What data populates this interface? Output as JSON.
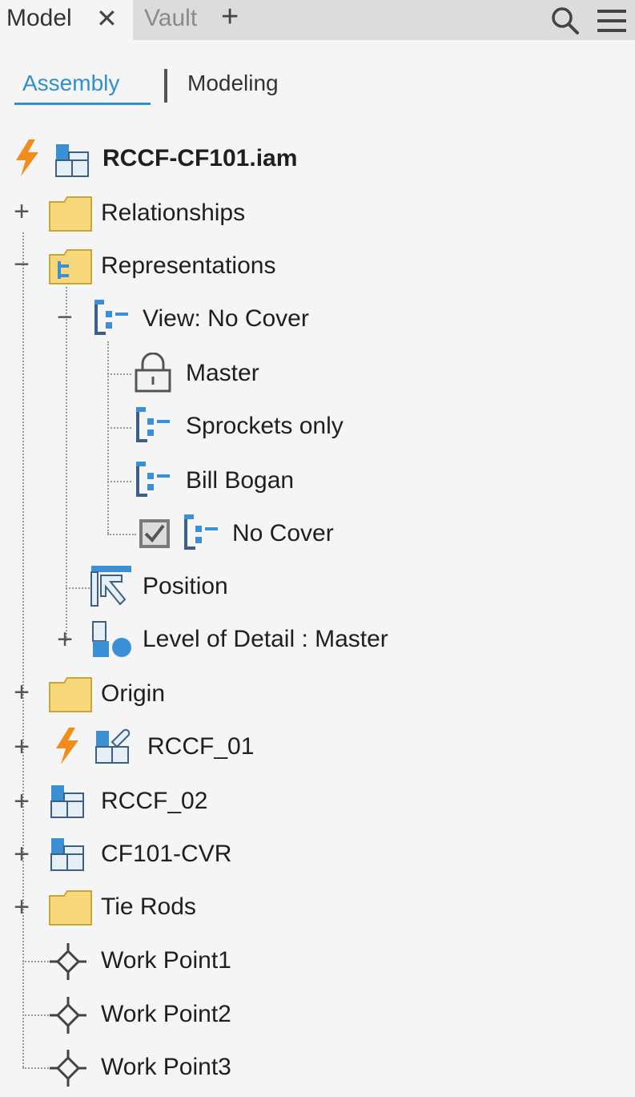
{
  "tabs": {
    "model_label": "Model",
    "close_glyph": "✕",
    "vault_label": "Vault",
    "add_glyph": "+"
  },
  "toolbar_icons": [
    "search-icon",
    "hamburger-menu-icon"
  ],
  "subtabs": {
    "assembly": "Assembly",
    "modeling": "Modeling",
    "active": "Assembly"
  },
  "colors": {
    "accent": "#2f8fd1",
    "folder": "#f6d77a",
    "lightning": "#f28c1c",
    "assembly_icon": "#3b8fd4"
  },
  "tree": {
    "root": "RCCF-CF101.iam",
    "relationships": "Relationships",
    "representations": "Representations",
    "view_rep": "View: No Cover",
    "master": "Master",
    "sprockets": "Sprockets only",
    "bill": "Bill Bogan",
    "nocover": "No Cover",
    "position": "Position",
    "lod": "Level of Detail : Master",
    "origin": "Origin",
    "rccf01": "RCCF_01",
    "rccf02": "RCCF_02",
    "cf101cvr": "CF101-CVR",
    "tierods": "Tie Rods",
    "wp1": "Work Point1",
    "wp2": "Work Point2",
    "wp3": "Work Point3"
  },
  "expander": {
    "plus": "+",
    "minus": "−"
  }
}
